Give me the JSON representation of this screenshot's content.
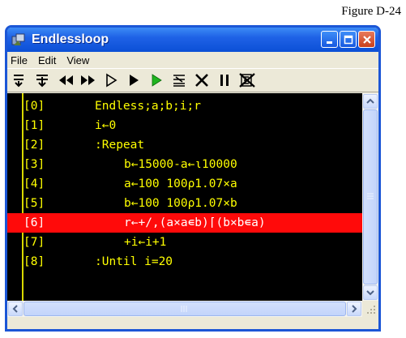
{
  "caption": "Figure D-24",
  "window": {
    "title": "Endlessloop",
    "app_icon": "workspace-icon"
  },
  "menu": [
    "File",
    "Edit",
    "View"
  ],
  "toolbar": [
    "step-over-icon",
    "step-into-icon",
    "rewind-icon",
    "fast-forward-icon",
    "run-to-icon",
    "run-icon",
    "continue-icon",
    "trace-list-icon",
    "cancel-icon",
    "pause-icon",
    "clear-stops-icon"
  ],
  "code": {
    "highlight_color": "#ff0a0a",
    "text_color": "#ffff00",
    "highlighted_line": 6,
    "lines": [
      {
        "num": "[0]",
        "text": "Endless;a;b;i;r",
        "indent": 0
      },
      {
        "num": "[1]",
        "text": "i←0",
        "indent": 0
      },
      {
        "num": "[2]",
        "text": ":Repeat",
        "indent": 0
      },
      {
        "num": "[3]",
        "text": "b←15000-a←ι10000",
        "indent": 1
      },
      {
        "num": "[4]",
        "text": "a←100 100ρ1.07×a",
        "indent": 1
      },
      {
        "num": "[5]",
        "text": "b←100 100ρ1.07×b",
        "indent": 1
      },
      {
        "num": "[6]",
        "text": "r←+/,(a×a∊b)⌈(b×b∊a)",
        "indent": 1
      },
      {
        "num": "[7]",
        "text": "+i←i+1",
        "indent": 1
      },
      {
        "num": "[8]",
        "text": ":Until i=20",
        "indent": 0
      }
    ]
  }
}
